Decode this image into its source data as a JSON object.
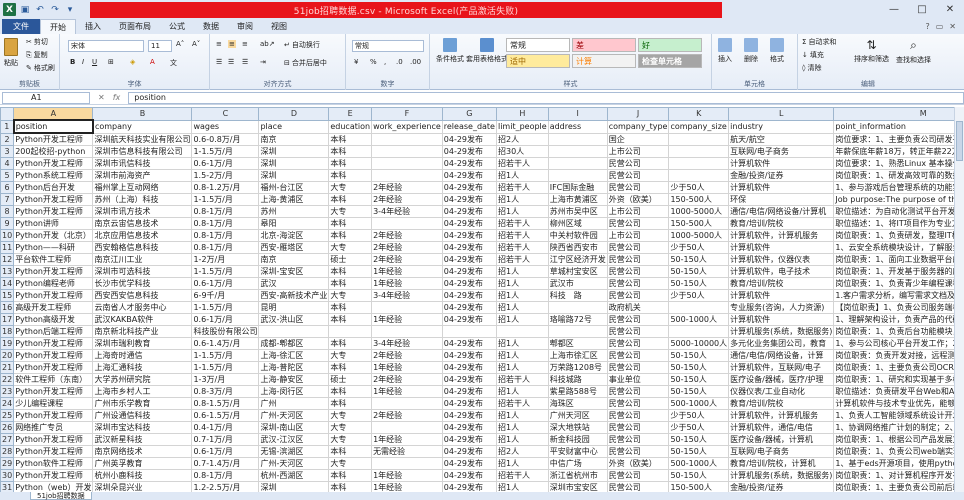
{
  "window": {
    "title": "51job招聘数据.csv - Microsoft Excel(产品激活失败)",
    "controls": [
      "—",
      "□",
      "✕"
    ]
  },
  "ribbon_tabs": [
    "文件",
    "开始",
    "插入",
    "页面布局",
    "公式",
    "数据",
    "审阅",
    "视图"
  ],
  "ribbon": {
    "clipboard": {
      "cut": "剪切",
      "copy": "复制",
      "paste": "粘贴",
      "format_painter": "格式刷",
      "label": "剪贴板"
    },
    "font": {
      "name": "宋体",
      "size": "11",
      "label": "字体"
    },
    "alignment": {
      "wrap": "自动换行",
      "merge": "合并后居中",
      "label": "对齐方式"
    },
    "number": {
      "format": "常规",
      "label": "数字"
    },
    "styles": {
      "conditional": "条件格式",
      "table": "套用表格格式",
      "normal": "常规",
      "bad": "差",
      "good": "好",
      "neutral": "适中",
      "calc": "计算",
      "check": "检查单元格",
      "label": "样式"
    },
    "cells": {
      "insert": "插入",
      "delete": "删除",
      "format": "格式",
      "label": "单元格"
    },
    "editing": {
      "autosum": "自动求和",
      "fill": "填充",
      "clear": "清除",
      "sort": "排序和筛选",
      "find": "查找和选择",
      "label": "编辑"
    }
  },
  "formula_bar": {
    "name_box": "A1",
    "fx": "fx",
    "content": "position"
  },
  "columns": [
    "A",
    "B",
    "C",
    "D",
    "E",
    "F",
    "G",
    "H",
    "I",
    "J",
    "K",
    "L",
    "M",
    "N",
    "O",
    "P"
  ],
  "rows": [
    [
      "1",
      "position",
      "company",
      "wages",
      "place",
      "education",
      "work_experience",
      "release_date",
      "limit_people",
      "address",
      "company_type",
      "company_size",
      "industry",
      "point_information",
      "",
      "",
      ""
    ],
    [
      "2",
      "Python开发工程师",
      "深圳航天科技实业有限公司",
      "0.6-0.8万/月",
      "南京",
      "本科",
      "",
      "04-29发布",
      "招2人",
      "",
      "国企",
      "",
      "航天/航空",
      "岗位要求：1、主要负责公司研发平台的开发",
      "",
      "",
      ""
    ],
    [
      "3",
      "200起校招-python",
      "深圳市信息科技有限公司",
      "1-1.5万/月",
      "深圳",
      "本科",
      "",
      "04-29发布",
      "招30人",
      "",
      "上市公司",
      "",
      "互联网/电子商务",
      "年薪保底年薪18万，转正年薪22万+岗位描述",
      "",
      "",
      ""
    ],
    [
      "4",
      "Python开发工程师",
      "深圳市讯信科技",
      "0.6-1万/月",
      "深圳",
      "本科",
      "",
      "04-29发布",
      "招若干人",
      "",
      "民营公司",
      "",
      "计算机软件",
      "岗位要求：1、熟悉Linux 基本操作；2、了解",
      "",
      "",
      ""
    ],
    [
      "5",
      "Python系统工程师",
      "深圳市前海资产",
      "1.5-2万/月",
      "深圳",
      "本科",
      "",
      "04-29发布",
      "招1人",
      "",
      "民营公司",
      "",
      "金融/投资/证券",
      "岗位职责：1、研发高效可靠的数据平台",
      "",
      "",
      ""
    ],
    [
      "6",
      "Python后台开发",
      "福州掌上互动网络",
      "0.8-1.2万/月",
      "福州-台江区",
      "大专",
      "2年经验",
      "04-29发布",
      "招若干人",
      "IFC国际金融",
      "民营公司",
      "少于50人",
      "计算机软件",
      "1、参与游戏后台管理系统的功能实现；2、",
      "",
      "",
      ""
    ],
    [
      "7",
      "Python开发工程师",
      "苏州（上海）科技",
      "1-1.5万/月",
      "上海-黄浦区",
      "本科",
      "2年经验",
      "04-29发布",
      "招1人",
      "上海市黄浦区",
      "外资（欧美）",
      "150-500人",
      "环保",
      "Job purpose:The purpose of the recruitment",
      "",
      "",
      ""
    ],
    [
      "8",
      "Python开发工程师",
      "深圳市讯方技术",
      "0.8-1万/月",
      "苏州",
      "大专",
      "3-4年经验",
      "04-29发布",
      "招1人",
      "苏州市吴中区",
      "上市公司",
      "1000-5000人",
      "通信/电信/网络设备/计算机",
      "职位描述：为自动化测试平台开发Python程序",
      "",
      "",
      ""
    ],
    [
      "9",
      "Python讲师",
      "南京云宙信息技术",
      "0.8-1万/月",
      "皋阳",
      "本科",
      "",
      "04-29发布",
      "招若干人",
      "柳州区域",
      "民营公司",
      "150-500人",
      "教育/培训/院校",
      "职位描述：1、将IT项目作为专业方向",
      "",
      "",
      ""
    ],
    [
      "10",
      "Python开发（北京）",
      "北京应用信息技术",
      "0.8-1万/月",
      "北京-海淀区",
      "本科",
      "2年经验",
      "04-29发布",
      "招若干人",
      "中关村软件园",
      "上市公司",
      "1000-5000人",
      "计算机软件，计算机服务",
      "岗位职责：1、负责研发，整理IT框架",
      "",
      "",
      ""
    ],
    [
      "11",
      "Python——科研",
      "西安翰格信息科技",
      "0.8-1万/月",
      "西安-雁塔区",
      "大专",
      "2年经验",
      "04-29发布",
      "招若干人",
      "陕西省西安市",
      "民营公司",
      "少于50人",
      "计算机软件",
      "1、云安全系统模块设计，了解服务程序",
      "",
      "",
      ""
    ],
    [
      "12",
      "平台软件工程师",
      "南京江川工业",
      "1-2万/月",
      "南京",
      "硕士",
      "2年经验",
      "04-29发布",
      "招若干人",
      "江宁区经济开发",
      "民营公司",
      "50-150人",
      "计算机软件，仪器仪表",
      "岗位职责：1、面向工业数据平台的功能",
      "",
      "",
      ""
    ],
    [
      "13",
      "Python开发工程师",
      "深圳市可选科技",
      "1-1.5万/月",
      "深圳-宝安区",
      "本科",
      "1年经验",
      "04-29发布",
      "招1人",
      "草城村宝安区",
      "民营公司",
      "50-150人",
      "计算机软件，电子技术",
      "岗位职责：1、开发基于服务器的应用程序",
      "",
      "",
      ""
    ],
    [
      "14",
      "Python编程老师",
      "长沙市优学科技",
      "0.6-1万/月",
      "武汉",
      "本科",
      "1年经验",
      "04-29发布",
      "招1人",
      "武汉市",
      "民营公司",
      "50-150人",
      "教育/培训/院校",
      "岗位职责：1、负责青少年编程课程的讲授",
      "",
      "",
      ""
    ],
    [
      "15",
      "Python开发工程师",
      "西安西安信息科技",
      "6-9千/月",
      "西安-高新技术产业",
      "大专",
      "3-4年经验",
      "04-29发布",
      "招1人",
      "科技　路",
      "民营公司",
      "少于50人",
      "计算机软件",
      "1.客户需求分析，编写需求文档及系统实现",
      "",
      "",
      ""
    ],
    [
      "16",
      "高级开发工程师",
      "云南省人才服务中心",
      "1-1.5万/月",
      "昆明",
      "本科",
      "",
      "04-29发布",
      "招1人",
      "",
      "政府机关",
      "",
      "专业服务(咨询，人力资源)",
      "【岗位职责】1、负责公司服务端相关业务",
      "",
      "",
      ""
    ],
    [
      "17",
      "Python高级开发",
      "武汉KAKBA软件",
      "0.6-1万/月",
      "武汉-洪山区",
      "本科",
      "1年经验",
      "04-29发布",
      "招1人",
      "珞喻路72号",
      "民营公司",
      "500-1000人",
      "计算机软件",
      "1、理解架构设计，负责产品的代码编写",
      "",
      "",
      ""
    ],
    [
      "18",
      "Python后端工程师",
      "南京新北科技产业",
      "科技股份有限公司",
      "",
      "",
      "",
      "",
      "",
      "",
      "民营公司",
      "",
      "计算机服务(系统，数据服务)",
      "岗位职责：1、负责后台功能模块，业务系统",
      "",
      "",
      ""
    ],
    [
      "19",
      "Python开发工程师",
      "深圳市瑞利教育",
      "0.6-1.4万/月",
      "成都-郫都区",
      "本科",
      "3-4年经验",
      "04-29发布",
      "招1人",
      "郫都区",
      "民营公司",
      "5000-10000人",
      "多元化业务集团公司，教育",
      "1、参与公司核心平台开发工作；2、",
      "",
      "",
      ""
    ],
    [
      "20",
      "Python开发工程师",
      "上海奇时通信",
      "1-1.5万/月",
      "上海-徐汇区",
      "大专",
      "2年经验",
      "04-29发布",
      "招1人",
      "上海市徐汇区",
      "民营公司",
      "50-150人",
      "通信/电信/网络设备，计算",
      "岗位职责：负责开发对接，远程测试工作",
      "",
      "",
      ""
    ],
    [
      "21",
      "Python开发工程师",
      "上海汇通科技",
      "1-1.5万/月",
      "上海-普陀区",
      "本科",
      "1年经验",
      "04-29发布",
      "招1人",
      "万荣路1208号",
      "民营公司",
      "50-150人",
      "计算机软件，互联网/电子",
      "岗位职责：1、主要负责公司OCR 识别业务",
      "",
      "",
      ""
    ],
    [
      "22",
      "软件工程师（东南）",
      "大学苏州研究院",
      "1-3万/月",
      "上海-静安区",
      "硕士",
      "2年经验",
      "04-29发布",
      "招若干人",
      "科技城路",
      "事业单位",
      "50-150人",
      "医疗设备/器械，医疗/护理",
      "岗位职责：1、研究和实现基于多模态的编程",
      "",
      "",
      ""
    ],
    [
      "23",
      "Python开发工程师",
      "上海市乡村人工",
      "0.8-3万/月",
      "上海-闵行区",
      "本科",
      "1年经验",
      "04-29发布",
      "招1人",
      "紫星路588号",
      "民营公司",
      "50-150人",
      "仪器仪表/工业自动化",
      "职位描述：负责研发平台Web和AI平台开发",
      "",
      "",
      ""
    ],
    [
      "24",
      "少儿编程课程",
      "广州市乐学教育",
      "0.8-1.5万/月",
      "广州",
      "本科",
      "",
      "04-29发布",
      "招若干人",
      "海珠区",
      "民营公司",
      "500-1000人",
      "教育/培训/院校",
      "计算机软件与技术专业优先，能够",
      "",
      "",
      ""
    ],
    [
      "25",
      "Python开发工程师",
      "广州设通信科技",
      "0.6-1.5万/月",
      "广州-天河区",
      "大专",
      "2年经验",
      "04-29发布",
      "招1人",
      "广州天河区",
      "民营公司",
      "少于50人",
      "计算机软件，计算机服务",
      "1、负责人工智能领域系统设计开发工作；2、",
      "",
      "",
      ""
    ],
    [
      "26",
      "网络推广专员",
      "深圳市宝达科技",
      "0.4-1万/月",
      "深圳-南山区",
      "大专",
      "",
      "04-29发布",
      "招1人",
      "深大地铁站",
      "民营公司",
      "少于50人",
      "计算机软件，通信/电信",
      "1、协调网络推广计划的制定；2、协助完成",
      "",
      "",
      ""
    ],
    [
      "27",
      "Python开发工程师",
      "武汉新星科技",
      "0.7-1万/月",
      "武汉-江汉区",
      "大专",
      "1年经验",
      "04-29发布",
      "招1人",
      "新金科技园",
      "民营公司",
      "50-150人",
      "医疗设备/器械，计算机",
      "岗位职责：1、根据公司产品发展方向，参与",
      "",
      "",
      ""
    ],
    [
      "28",
      "Python开发工程师",
      "南京网络技术",
      "0.6-1万/月",
      "无锡-滨湖区",
      "本科",
      "无需经验",
      "04-29发布",
      "招2人",
      "平安财富中心",
      "民营公司",
      "50-150人",
      "互联网/电子商务",
      "岗位职责：1、负责公司web端实现；2、负责",
      "",
      "",
      ""
    ],
    [
      "29",
      "Python软件工程师",
      "广州英孚教育",
      "0.7-1.4万/月",
      "广州-天河区",
      "大专",
      "",
      "04-29发布",
      "招1人",
      "中信广场",
      "外资（欧美）",
      "500-1000人",
      "教育/培训/院校，计算机",
      "1、基于eds开源项目，使用python语言，参与",
      "",
      "",
      ""
    ],
    [
      "30",
      "Python开发工程师",
      "杭州小鹿科技",
      "0.8-1万/月",
      "杭州-西湖区",
      "本科",
      "1年经验",
      "04-29发布",
      "招若干人",
      "浙江省杭州市",
      "民营公司",
      "50-150人",
      "计算机服务(系统，数据服务)",
      "岗位职责：1、对计算机程序开发有浓厚兴趣",
      "",
      "",
      ""
    ],
    [
      "31",
      "Python（web）开发",
      "深圳朵昆兴业",
      "1.2-2.5万/月",
      "深圳",
      "本科",
      "1年经验",
      "04-29发布",
      "招1人",
      "深圳市宝安区",
      "民营公司",
      "150-500人",
      "金融/投资/证券",
      "岗位职责：1、主要负责公司前后端的开发",
      "",
      "",
      ""
    ]
  ],
  "sheet_tab": "51job招聘数据",
  "colors": {
    "file_tab": "#2b579a",
    "title_bar": "#e8141a",
    "excel_green": "#1e7145",
    "header_bg": "#e4ecf7",
    "selected_header": "#f9d99f"
  }
}
